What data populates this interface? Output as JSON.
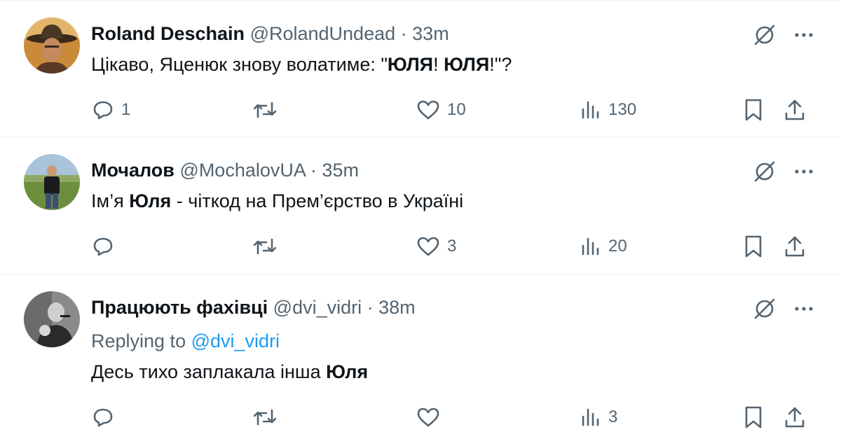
{
  "tweets": [
    {
      "name": "Roland Deschain",
      "handle": "@RolandUndead",
      "dot": "·",
      "time": "33m",
      "text_parts": [
        "Цікаво, Яценюк знову волатиме: \"",
        "ЮЛЯ",
        "! ",
        "ЮЛЯ",
        "!\"?"
      ],
      "replies": "1",
      "retweets": "",
      "likes": "10",
      "views": "130"
    },
    {
      "name": "Мочалов",
      "handle": "@MochalovUA",
      "dot": "·",
      "time": "35m",
      "text_parts": [
        "Ім’я ",
        "Юля",
        " - чіткод на Прем’єрство в Україні"
      ],
      "replies": "",
      "retweets": "",
      "likes": "3",
      "views": "20"
    },
    {
      "name": "Працюють фахівці",
      "handle": "@dvi_vidri",
      "dot": "·",
      "time": "38m",
      "replying_prefix": "Replying to",
      "replying_mention": "@dvi_vidri",
      "text_parts": [
        "Десь тихо заплакала інша ",
        "Юля"
      ],
      "replies": "",
      "retweets": "",
      "likes": "",
      "views": "3"
    }
  ],
  "icons": {
    "mute": "circle-slash-icon",
    "more": "more-horizontal-icon",
    "reply": "reply-bubble-icon",
    "retweet": "retweet-icon",
    "like": "heart-icon",
    "views": "views-chart-icon",
    "bookmark": "bookmark-icon",
    "share": "share-icon"
  },
  "colors": {
    "text": "#0f1419",
    "secondary": "#536471",
    "link": "#1d9bf0",
    "divider": "#eff3f4"
  }
}
